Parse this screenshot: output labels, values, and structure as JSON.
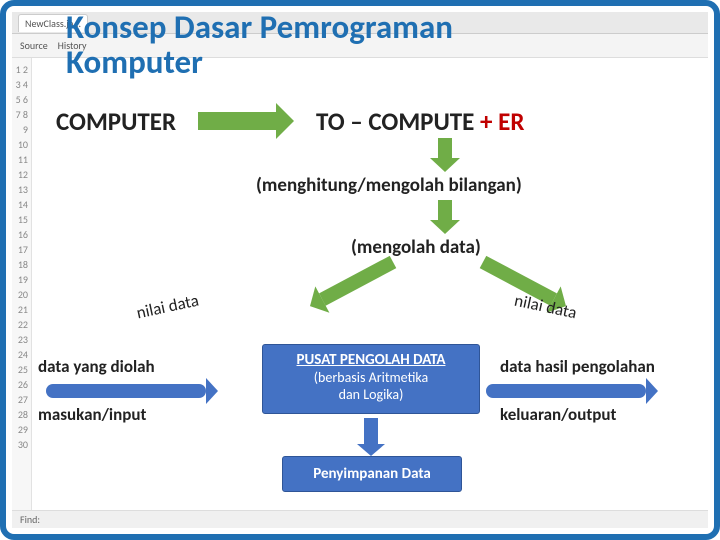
{
  "ide": {
    "tab": "NewClass.ja...",
    "toolbar_labels": [
      "Source",
      "History"
    ],
    "status_find": "Find:",
    "gutter_start": 1,
    "gutter_end": 30
  },
  "slide": {
    "title_line1": "Konsep Dasar Pemrograman",
    "title_line2": "Komputer",
    "computer": "COMPUTER",
    "to": "TO – COMPUTE ",
    "er": "+ ER",
    "sub1": "(menghitung/mengolah bilangan)",
    "sub2": "(mengolah data)",
    "nilai_left": "nilai data",
    "nilai_right": "nilai data",
    "left1": "data yang diolah",
    "left2": "masukan/input",
    "mid_h": "PUSAT PENGOLAH DATA",
    "mid_s1": "(berbasis Aritmetika",
    "mid_s2": "dan Logika)",
    "right1": "data hasil pengolahan",
    "right2": "keluaran/output",
    "storage": "Penyimpanan Data"
  }
}
